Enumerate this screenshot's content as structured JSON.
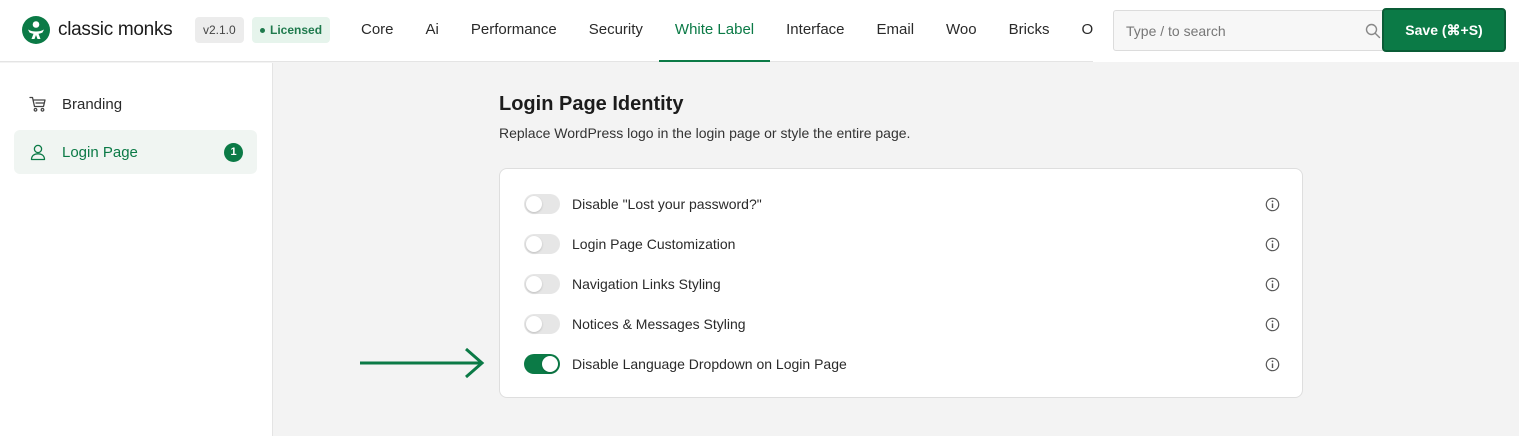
{
  "brand": {
    "name": "classic monks",
    "version": "v2.1.0",
    "license": "Licensed",
    "color": "#0b7a46"
  },
  "nav": {
    "items": [
      "Core",
      "Ai",
      "Performance",
      "Security",
      "White Label",
      "Interface",
      "Email",
      "Woo",
      "Bricks",
      "Opt"
    ],
    "active": "White Label"
  },
  "search": {
    "placeholder": "Type / to search",
    "icon": "search-icon"
  },
  "save": {
    "label": "Save (⌘+S)"
  },
  "sidebar": {
    "items": [
      {
        "label": "Branding",
        "icon": "cart-icon",
        "badge": ""
      },
      {
        "label": "Login Page",
        "icon": "user-icon",
        "badge": "1",
        "active": true
      }
    ]
  },
  "main": {
    "title": "Login Page Identity",
    "subtitle": "Replace WordPress logo in the login page or style the entire page.",
    "settings": [
      {
        "label": "Disable \"Lost your password?\"",
        "enabled": false,
        "icon": "info-icon"
      },
      {
        "label": "Login Page Customization",
        "enabled": false,
        "icon": "info-icon"
      },
      {
        "label": "Navigation Links Styling",
        "enabled": false,
        "icon": "info-icon"
      },
      {
        "label": "Notices & Messages Styling",
        "enabled": false,
        "icon": "info-icon"
      },
      {
        "label": "Disable Language Dropdown on Login Page",
        "enabled": true,
        "icon": "info-icon"
      }
    ]
  }
}
